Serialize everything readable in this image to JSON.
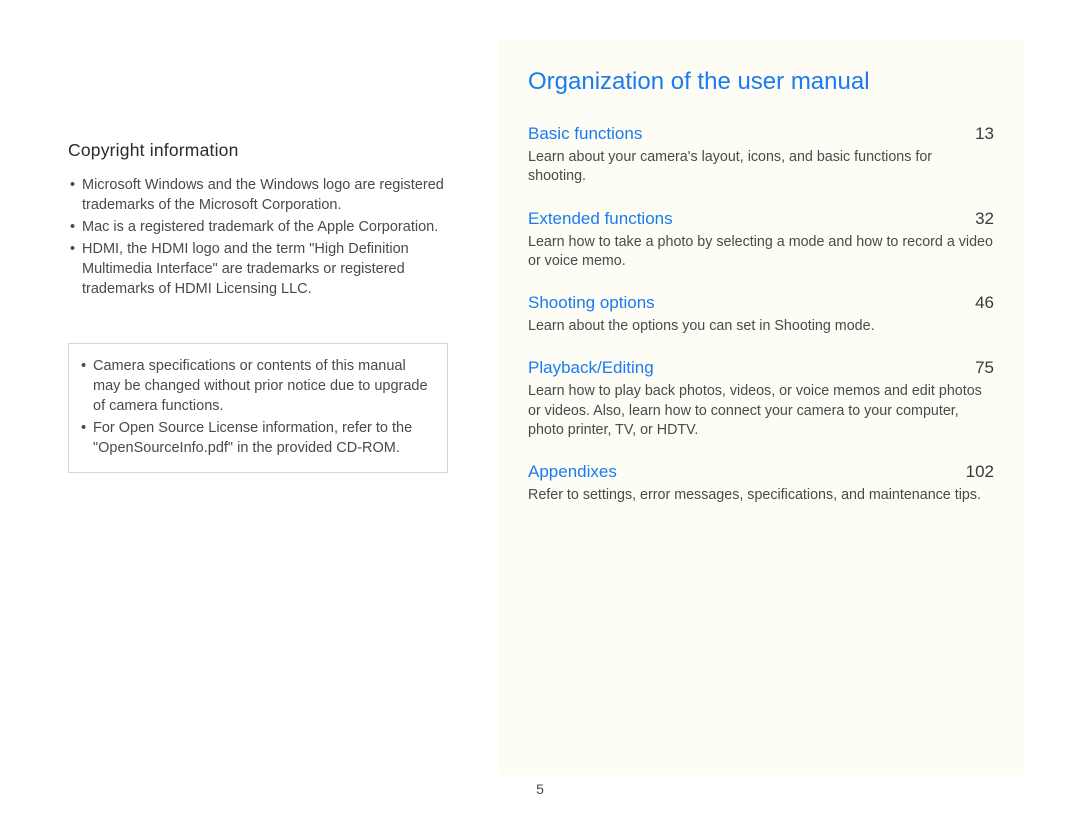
{
  "left": {
    "heading": "Copyright information",
    "bullets": [
      "Microsoft Windows and the Windows logo are registered trademarks of the Microsoft Corporation.",
      "Mac is a registered trademark of the Apple Corporation.",
      "HDMI, the HDMI logo and the term \"High Definition Multimedia Interface\" are trademarks or registered trademarks of HDMI Licensing LLC."
    ],
    "note_bullets": [
      "Camera specifications or contents of this manual may be changed without prior notice due to upgrade of camera functions.",
      "For Open Source License information, refer to the \"OpenSourceInfo.pdf\" in the provided CD-ROM."
    ]
  },
  "right": {
    "title": "Organization of the user manual",
    "toc": [
      {
        "title": "Basic functions",
        "page": "13",
        "desc": "Learn about your camera's layout, icons, and basic functions for shooting."
      },
      {
        "title": "Extended functions",
        "page": "32",
        "desc": "Learn how to take a photo by selecting a mode and how to record a video or voice memo."
      },
      {
        "title": "Shooting options",
        "page": "46",
        "desc": "Learn about the options you can set in Shooting mode."
      },
      {
        "title": "Playback/Editing",
        "page": "75",
        "desc": "Learn how to play back photos, videos, or voice memos and edit photos or videos. Also, learn how to connect your camera to your computer, photo printer, TV, or HDTV."
      },
      {
        "title": "Appendixes",
        "page": "102",
        "desc": "Refer to settings, error messages, specifications, and maintenance tips."
      }
    ]
  },
  "page_number": "5"
}
